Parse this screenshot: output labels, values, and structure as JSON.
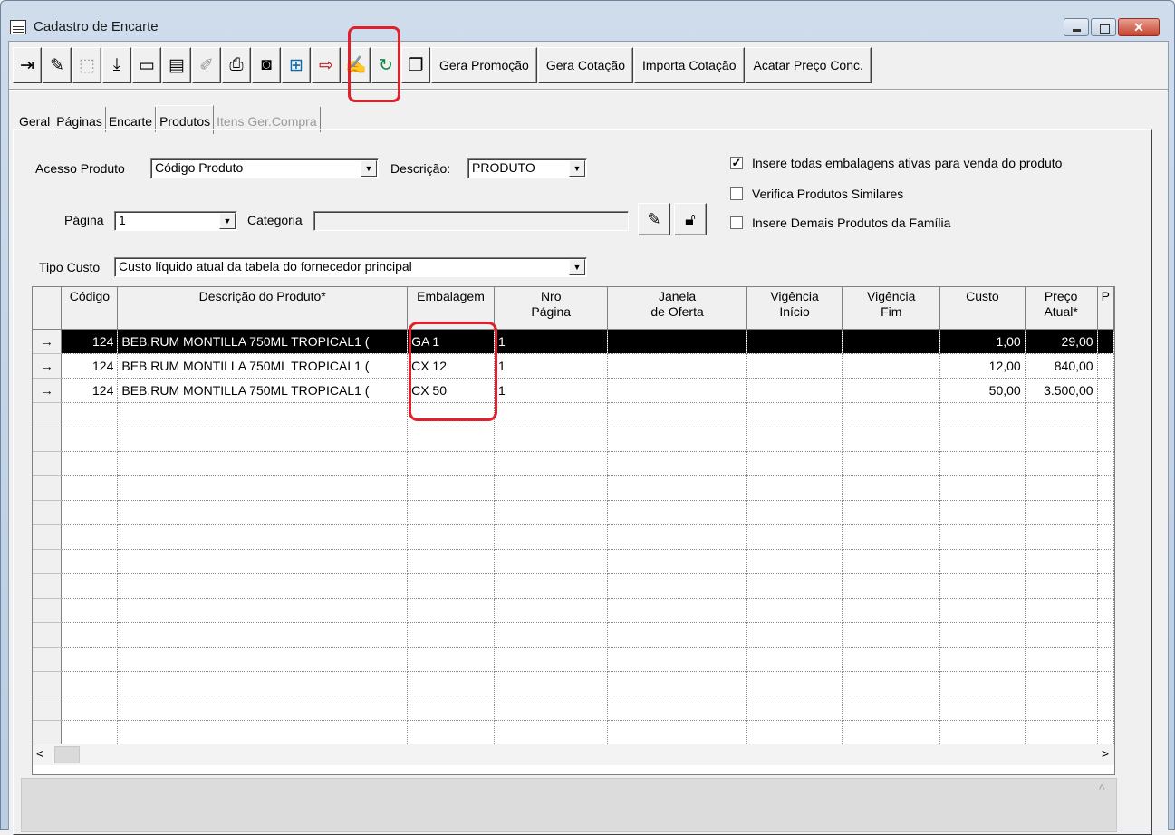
{
  "window": {
    "title": "Cadastro de Encarte"
  },
  "toolbar": {
    "icons": [
      "exit-icon",
      "edit-icon",
      "disabled-icon",
      "save-icon",
      "delete-icon",
      "list-icon",
      "disabled-icon-2",
      "print-icon",
      "camera-icon",
      "add-product-icon",
      "export-icon",
      "note-icon",
      "refresh-icon",
      "copy-icon"
    ],
    "buttons": [
      "Gera Promoção",
      "Gera Cotação",
      "Importa Cotação",
      "Acatar Preço Conc."
    ]
  },
  "tabs": [
    "Geral",
    "Páginas",
    "Encarte",
    "Produtos",
    "Itens Ger.Compra"
  ],
  "form": {
    "acesso_label": "Acesso Produto",
    "acesso_value": "Código Produto",
    "descricao_label": "Descrição:",
    "descricao_value": "PRODUTO",
    "pagina_label": "Página",
    "pagina_value": "1",
    "categoria_label": "Categoria",
    "categoria_value": "",
    "tipo_custo_label": "Tipo Custo",
    "tipo_custo_value": "Custo líquido atual da tabela do fornecedor principal",
    "chk_insere_todas": "Insere todas embalagens ativas para venda do produto",
    "chk_verifica": "Verifica Produtos Similares",
    "chk_insere_familia": "Insere Demais Produtos da Família"
  },
  "grid": {
    "headers": [
      "Código",
      "Descrição do Produto*",
      "Embalagem",
      "Nro\nPágina",
      "Janela\nde Oferta",
      "Vigência\nInício",
      "Vigência\nFim",
      "Custo",
      "Preço\nAtual*",
      "P"
    ],
    "rows": [
      {
        "codigo": "124",
        "descricao": "BEB.RUM MONTILLA 750ML TROPICAL1 (",
        "embalagem": "GA  1",
        "pagina": "1",
        "custo": "1,00",
        "preco": "29,00"
      },
      {
        "codigo": "124",
        "descricao": "BEB.RUM MONTILLA 750ML TROPICAL1 (",
        "embalagem": "CX  12",
        "pagina": "1",
        "custo": "12,00",
        "preco": "840,00"
      },
      {
        "codigo": "124",
        "descricao": "BEB.RUM MONTILLA 750ML TROPICAL1 (",
        "embalagem": "CX  50",
        "pagina": "1",
        "custo": "50,00",
        "preco": "3.500,00"
      }
    ]
  }
}
